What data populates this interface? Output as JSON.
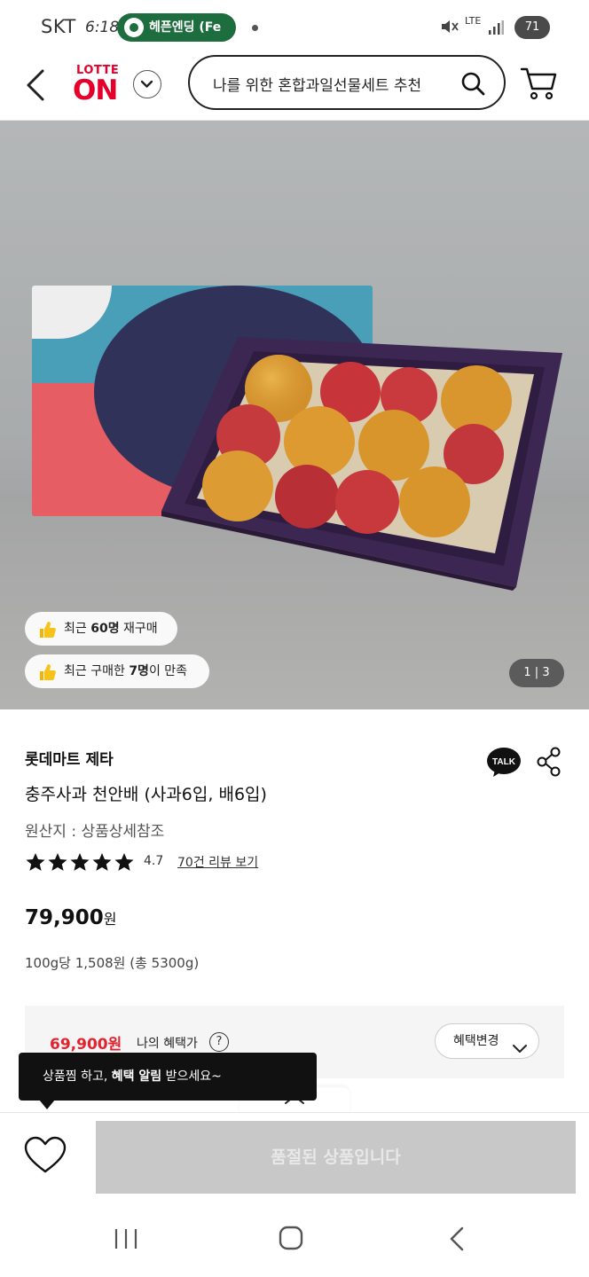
{
  "status_bar": {
    "carrier": "SKT",
    "time": "6:18",
    "notification_pill": "헤픈엔딩 (Fe",
    "network": "LTE",
    "battery": "71"
  },
  "header": {
    "logo_top": "LOTTE",
    "logo_bottom": "ON",
    "search_text": "나를 위한 혼합과일선물세트 추천"
  },
  "product_image": {
    "badge_1": {
      "prefix": "최근 ",
      "highlight": "60명",
      "suffix": " 재구매"
    },
    "badge_2": {
      "prefix": "최근 구매한 ",
      "highlight": "7명",
      "suffix": "이 만족"
    },
    "counter": "1 | 3"
  },
  "product": {
    "brand": "롯데마트 제타",
    "name": "충주사과 천안배 (사과6입, 배6입)",
    "origin": "원산지 : 상품상세참조",
    "rating": "4.7",
    "stars_count": 5,
    "review_link": "70건 리뷰 보기",
    "price": "79,900",
    "price_unit": "원",
    "unit_price": "100g당 1,508원 (총 5300g)"
  },
  "benefit": {
    "price": "69,900원",
    "label": "나의 혜택가",
    "help": "?",
    "change_button": "혜택변경"
  },
  "tooltip": {
    "prefix": "상품찜 하고, ",
    "highlight": "혜택 알림",
    "suffix": " 받으세요~"
  },
  "bottom_bar": {
    "soldout_label": "품절된 상품입니다"
  },
  "colors": {
    "brand_red": "#e4002b",
    "benefit_red": "#e4222e",
    "status_green": "#1e6d3f",
    "disabled_gray": "#c8c8c8"
  }
}
